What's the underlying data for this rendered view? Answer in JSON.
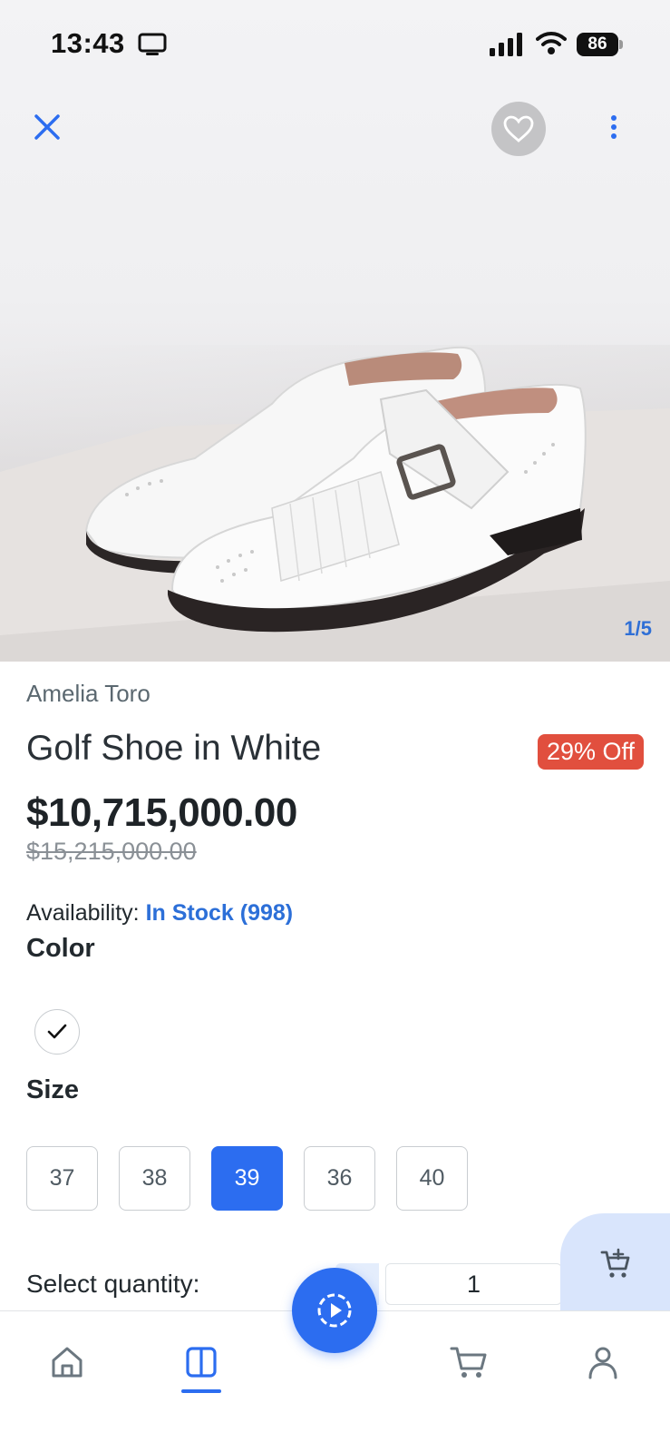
{
  "status_bar": {
    "time": "13:43",
    "battery_level": "86"
  },
  "gallery": {
    "counter": "1/5"
  },
  "product": {
    "brand": "Amelia Toro",
    "title": "Golf Shoe in White",
    "discount_badge": "29% Off",
    "price": "$10,715,000.00",
    "original_price": "$15,215,000.00",
    "availability_label": "Availability:",
    "availability_value": "In Stock (998)"
  },
  "color_section": {
    "label": "Color",
    "selected_swatch_color": "#ffffff"
  },
  "size_section": {
    "label": "Size",
    "options": [
      "37",
      "38",
      "39",
      "36",
      "40"
    ],
    "selected": "39"
  },
  "quantity_section": {
    "label": "Select quantity:",
    "value": "1"
  },
  "bottom_nav": {
    "items": [
      "home-icon",
      "catalog-icon",
      "cart-icon",
      "profile-icon"
    ],
    "active": "catalog-icon"
  },
  "colors": {
    "accent": "#2c6df0",
    "discount": "#e14f3e",
    "stock": "#2c6fd8"
  }
}
